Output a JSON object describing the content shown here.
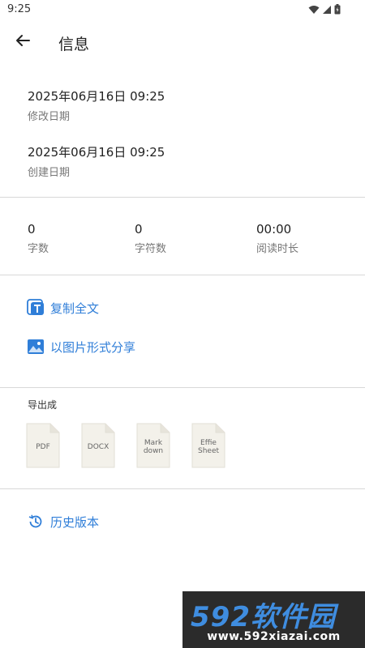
{
  "status_bar": {
    "time": "9:25",
    "icons": [
      "wifi-icon",
      "signal-icon",
      "battery-icon"
    ]
  },
  "app_bar": {
    "back_icon": "arrow-back-icon",
    "title": "信息"
  },
  "dates": {
    "modified": {
      "value": "2025年06月16日 09:25",
      "label": "修改日期"
    },
    "created": {
      "value": "2025年06月16日 09:25",
      "label": "创建日期"
    }
  },
  "stats": [
    {
      "value": "0",
      "label": "字数"
    },
    {
      "value": "0",
      "label": "字符数"
    },
    {
      "value": "00:00",
      "label": "阅读时长"
    }
  ],
  "actions": {
    "copy_all": {
      "label": "复制全文",
      "icon": "text-copy-icon"
    },
    "share_image": {
      "label": "以图片形式分享",
      "icon": "image-icon"
    }
  },
  "export": {
    "title": "导出成",
    "formats": [
      {
        "text": "PDF",
        "icon": "file-icon"
      },
      {
        "text": "DOCX",
        "icon": "file-icon"
      },
      {
        "text": "Mark\ndown",
        "icon": "file-icon"
      },
      {
        "text": "Effie\nSheet",
        "icon": "file-icon"
      }
    ]
  },
  "history": {
    "label": "历史版本",
    "icon": "history-icon"
  },
  "watermark": {
    "brand": "592软件园",
    "url": "www.592xiazai.com"
  },
  "colors": {
    "accent": "#2f7ed8",
    "divider": "#d8d8d8",
    "watermark_bg": "#2b2b2b"
  }
}
